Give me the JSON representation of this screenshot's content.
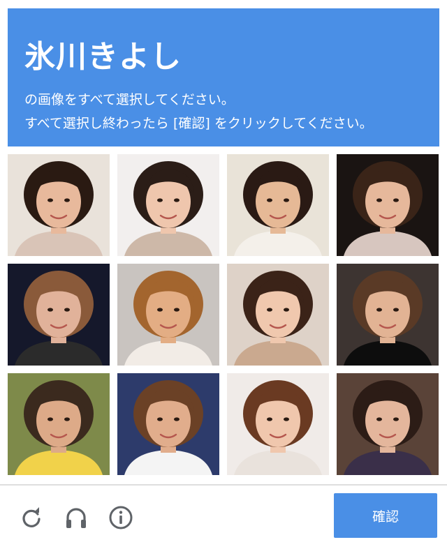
{
  "header": {
    "title": "氷川きよし",
    "line1": "の画像をすべて選択してください。",
    "line2": "すべて選択し終わったら [確認] をクリックしてください。"
  },
  "tiles": [
    {
      "name": "photo-woman-short-dark-hair",
      "bg": "#e9e2da",
      "hair": "#2a1a12",
      "skin": "#e8b99c",
      "cloth": "#d9c4b7"
    },
    {
      "name": "photo-woman-bob-dark-hair",
      "bg": "#f2efee",
      "hair": "#2b1d17",
      "skin": "#efc6ad",
      "cloth": "#cdb8a8"
    },
    {
      "name": "photo-man-smiling-fist",
      "bg": "#e9e3d8",
      "hair": "#2a1a14",
      "skin": "#e6b996",
      "cloth": "#f4f0ea"
    },
    {
      "name": "photo-woman-microphone",
      "bg": "#1a1412",
      "hair": "#3a2418",
      "skin": "#e6b89b",
      "cloth": "#d7c6bf"
    },
    {
      "name": "photo-performer-stage",
      "bg": "#15182b",
      "hair": "#8a5a3a",
      "skin": "#e1b29a",
      "cloth": "#2b2b2b"
    },
    {
      "name": "photo-woman-wavy-blonde",
      "bg": "#c9c4c0",
      "hair": "#a3652e",
      "skin": "#e3ad84",
      "cloth": "#f2ece6"
    },
    {
      "name": "photo-woman-long-dark-hair",
      "bg": "#ded2c8",
      "hair": "#3b2318",
      "skin": "#f0c8ae",
      "cloth": "#caa98f"
    },
    {
      "name": "photo-man-hand-on-chin",
      "bg": "#3d3431",
      "hair": "#5a3a26",
      "skin": "#e2b394",
      "cloth": "#0d0d0d"
    },
    {
      "name": "photo-person-baseball",
      "bg": "#7e8a4a",
      "hair": "#3b2a1e",
      "skin": "#ddaa88",
      "cloth": "#f1d24a"
    },
    {
      "name": "photo-man-long-hair-smiling",
      "bg": "#2d3b6b",
      "hair": "#6b4126",
      "skin": "#e1ad8c",
      "cloth": "#f4f4f4"
    },
    {
      "name": "photo-woman-auburn-bob",
      "bg": "#f0ebe8",
      "hair": "#6a3a22",
      "skin": "#f0c7ad",
      "cloth": "#e9e2dc"
    },
    {
      "name": "photo-woman-bookshelf",
      "bg": "#5a4338",
      "hair": "#2c1c16",
      "skin": "#e4b69c",
      "cloth": "#3a2f49"
    }
  ],
  "footer": {
    "reload_icon": "reload-icon",
    "audio_icon": "headphones-icon",
    "info_icon": "info-icon",
    "confirm_label": "確認"
  },
  "colors": {
    "accent": "#4a8fe6",
    "icon": "#5f6368"
  }
}
